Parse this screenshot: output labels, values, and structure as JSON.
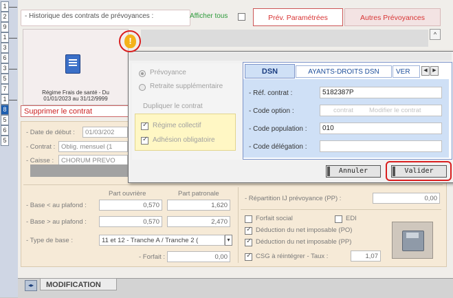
{
  "gutter_numbers": [
    "1",
    "2",
    "9",
    "1",
    "3",
    "6",
    "3",
    "5",
    "7",
    "1",
    "8",
    "5",
    "6",
    "5"
  ],
  "header": {
    "title": "- Historique des contrats de prévoyances :",
    "afficher_tous_label": "Afficher tous",
    "tab_prev_param": "Prév. Paramétrées",
    "tab_autres": "Autres Prévoyances",
    "scroll_up": "^"
  },
  "card": {
    "regime_line1": "Régime Frais de santé - Du",
    "regime_line2": "01/01/2023 au 31/12/9999",
    "supprimer": "Supprimer le contrat"
  },
  "warning_icon": "!",
  "form": {
    "date_debut_label": "- Date de début :",
    "date_debut_value": "01/03/202",
    "contrat_label": "- Contrat :",
    "contrat_value": "Oblig. mensuel (1",
    "caisse_label": "- Caisse :",
    "caisse_value": "CHORUM PREVO",
    "part_ouvriere": "Part ouvrière",
    "part_patronale": "Part patronale",
    "base_inf_label": "- Base < au plafond :",
    "base_inf_ouv": "0,570",
    "base_inf_pat": "1,620",
    "base_sup_label": "- Base > au plafond :",
    "base_sup_ouv": "0,570",
    "base_sup_pat": "2,470",
    "type_base_label": "- Type de base :",
    "type_base_value": "11 et 12 - Tranche A / Tranche 2 (",
    "forfait_label": "- Forfait :",
    "forfait_value": "0,00",
    "repartition_label": "- Répartition IJ prévoyance (PP) :",
    "repartition_value": "0,00",
    "forfait_social": "Forfait social",
    "edi": "EDI",
    "deduction_po": "Déduction du net imposable (PO)",
    "deduction_pp": "Déduction du net imposable (PP)",
    "csg_label": "CSG à réintégrer - Taux :",
    "csg_value": "1,07"
  },
  "dialog": {
    "radio_prevoyance": "Prévoyance",
    "radio_retraite": "Retraite supplémentaire",
    "dupliquer": "Dupliquer le contrat",
    "regime_collectif": "Régime collectif",
    "adhesion": "Adhésion obligatoire",
    "bg_contrat": "contrat",
    "bg_modifier": "Modifier le contrat",
    "tab_dsn": "DSN",
    "tab_ayants": "AYANTS-DROITS DSN",
    "tab_ver": "VER",
    "arrow_left": "◀",
    "arrow_right": "▶",
    "ref_contrat_label": "- Réf. contrat :",
    "ref_contrat_value": "5182387P",
    "code_option_label": "- Code option :",
    "code_option_value": "",
    "code_population_label": "- Code population :",
    "code_population_value": "010",
    "code_delegation_label": "- Code délégation :",
    "code_delegation_value": "",
    "annuler": "Annuler",
    "valider": "Valider"
  },
  "status": {
    "icon": "◂▸",
    "label": "MODIFICATION"
  },
  "colors": {
    "red_annotation": "#d91e1e",
    "tab_red": "#d83434",
    "green": "#2c9a3a",
    "dsn_blue": "#cfe0f6"
  }
}
